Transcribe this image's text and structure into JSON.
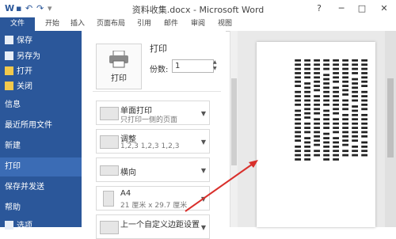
{
  "window": {
    "title": "资料收集.docx - Microsoft Word",
    "help": "?",
    "minimize": "─",
    "restore": "□",
    "close": "✕"
  },
  "quick_access": {
    "undo": "↶",
    "redo": "↷"
  },
  "tabs": [
    "文件",
    "开始",
    "插入",
    "页面布局",
    "引用",
    "邮件",
    "审阅",
    "视图"
  ],
  "sidebar": {
    "small_items": [
      {
        "label": "保存",
        "icon": "save-icon"
      },
      {
        "label": "另存为",
        "icon": "save-as-icon"
      },
      {
        "label": "打开",
        "icon": "open-folder-icon"
      },
      {
        "label": "关闭",
        "icon": "close-doc-icon"
      }
    ],
    "big_items": [
      "信息",
      "最近所用文件",
      "新建",
      "打印",
      "保存并发送",
      "帮助"
    ],
    "bottom_item": "选项"
  },
  "print": {
    "heading": "打印",
    "button_label": "打印",
    "copies_label": "份数:",
    "copies_value": "1"
  },
  "options": [
    {
      "title": "单面打印",
      "subtitle": "只打印一侧的页面",
      "icon": "single-side-icon"
    },
    {
      "title": "调整",
      "subtitle": "1,2,3    1,2,3    1,2,3",
      "icon": "collate-icon"
    },
    {
      "title": "横向",
      "subtitle": "",
      "icon": "orientation-icon"
    },
    {
      "title": "A4",
      "subtitle": "21 厘米 x 29.7 厘米",
      "icon": "paper-size-icon"
    },
    {
      "title": "上一个自定义边距设置",
      "subtitle": "",
      "icon": "margins-icon"
    }
  ],
  "colors": {
    "accent": "#2b579a",
    "arrow": "#d9302c"
  }
}
